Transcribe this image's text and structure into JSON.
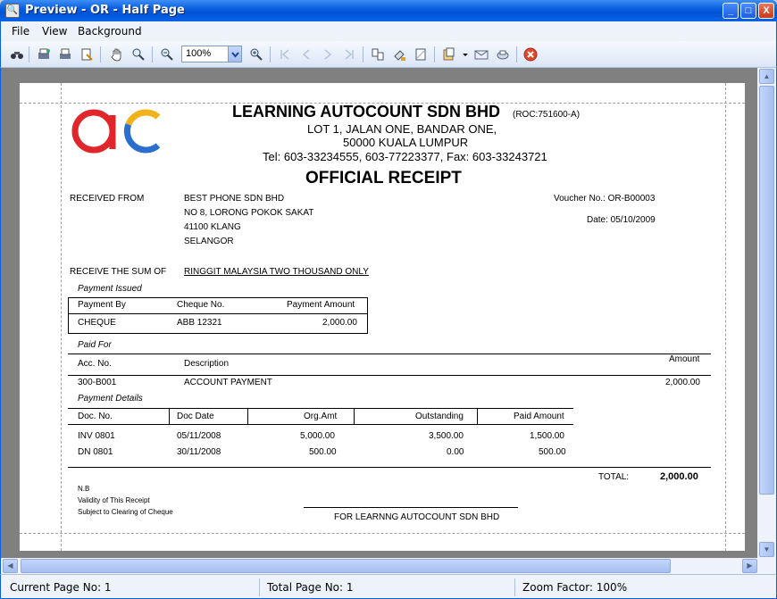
{
  "window": {
    "title": "Preview - OR - Half Page",
    "minimize": "_",
    "maximize": "□",
    "close": "X"
  },
  "menu": {
    "file": "File",
    "view": "View",
    "background": "Background"
  },
  "toolbar": {
    "zoom_value": "100%"
  },
  "statusbar": {
    "current_page": "Current Page No: 1",
    "total_page": "Total Page No: 1",
    "zoom_factor": "Zoom Factor: 100%"
  },
  "receipt": {
    "company": "LEARNING AUTOCOUNT SDN BHD",
    "roc": "(ROC:751600-A)",
    "addr1": "LOT 1, JALAN ONE,  BANDAR ONE,",
    "addr2": "50000  KUALA LUMPUR",
    "phones": "Tel:  603-33234555,  603-77223377,  Fax:  603-33243721",
    "heading": "OFFICIAL RECEIPT",
    "received_from_label": "RECEIVED FROM",
    "payer": [
      "BEST PHONE SDN BHD",
      "NO 8, LORONG POKOK SAKAT",
      "41100 KLANG",
      "SELANGOR"
    ],
    "voucher": "Voucher No.: OR-B00003",
    "date": "Date: 05/10/2009",
    "sum_label": "RECEIVE THE SUM OF",
    "sum_words": "RINGGIT MALAYSIA TWO THOUSAND ONLY",
    "payment_issued": {
      "title": "Payment Issued",
      "headers": [
        "Payment By",
        "Cheque No.",
        "Payment Amount"
      ],
      "row": [
        "CHEQUE",
        "ABB 12321",
        "2,000.00"
      ]
    },
    "paid_for": {
      "title": "Paid For",
      "headers": [
        "Acc. No.",
        "Description",
        "Amount"
      ],
      "row": [
        "300-B001",
        "ACCOUNT PAYMENT",
        "2,000.00"
      ]
    },
    "payment_details": {
      "title": "Payment Details",
      "headers": [
        "Doc. No.",
        "Doc Date",
        "Org.Amt",
        "Outstanding",
        "Paid Amount"
      ],
      "rows": [
        [
          "INV 0801",
          "05/11/2008",
          "5,000.00",
          "3,500.00",
          "1,500.00"
        ],
        [
          "DN 0801",
          "30/11/2008",
          "500.00",
          "0.00",
          "500.00"
        ]
      ]
    },
    "total_label": "TOTAL:",
    "total_value": "2,000.00",
    "notes": [
      "N.B",
      "Validity of This Receipt",
      "Subject to Clearing of Cheque"
    ],
    "signature": "FOR  LEARNNG AUTOCOUNT SDN BHD"
  }
}
